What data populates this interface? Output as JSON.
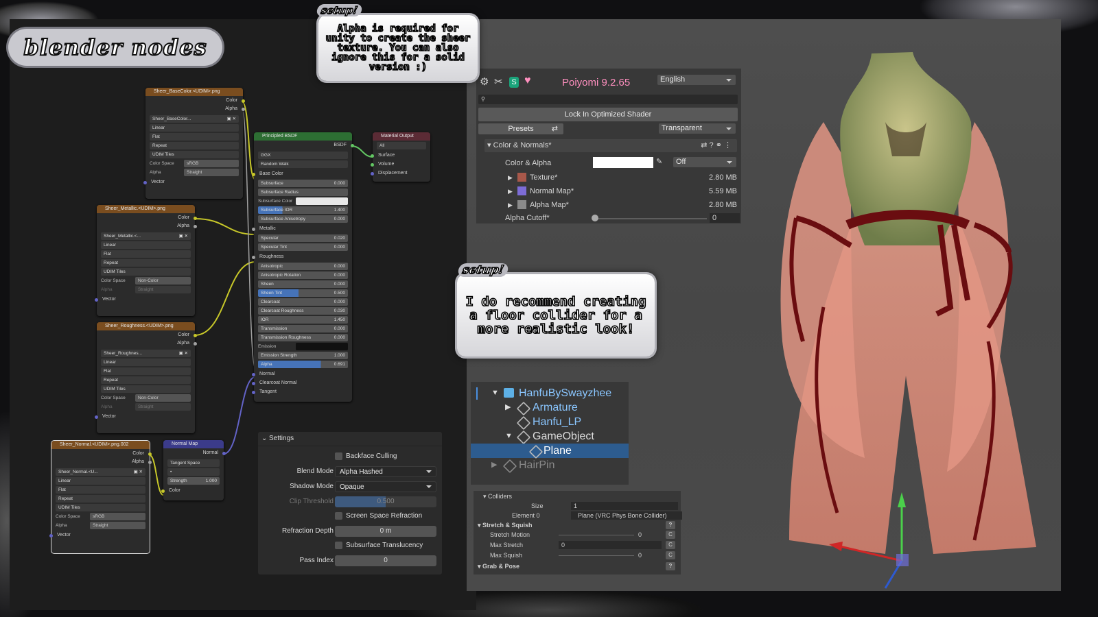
{
  "title": "blender nodes",
  "callout1": {
    "tag": "setup!",
    "text": "Alpha is required for unity to create the sheer texture. You can also ignore this for a solid version :)"
  },
  "callout2": {
    "tag": "setup!",
    "text": "I do recommend creating a floor collider for a more realistic look!"
  },
  "nodes": {
    "basecolor": {
      "title": "Sheer_BaseColor.<UDIM>.png",
      "out_color": "Color",
      "out_alpha": "Alpha",
      "image": "Sheer_BaseColor...",
      "interp": "Linear",
      "proj": "Flat",
      "ext": "Repeat",
      "src": "UDIM Tiles",
      "cs_label": "Color Space",
      "cs": "sRGB",
      "alpha_label": "Alpha",
      "alpha": "Straight",
      "vector": "Vector"
    },
    "metallic": {
      "title": "Sheer_Metallic.<UDIM>.png",
      "out_color": "Color",
      "out_alpha": "Alpha",
      "image": "Sheer_Metallic.<...",
      "interp": "Linear",
      "proj": "Flat",
      "ext": "Repeat",
      "src": "UDIM Tiles",
      "cs_label": "Color Space",
      "cs": "Non-Color",
      "alpha_label": "Alpha",
      "alpha": "Straight",
      "vector": "Vector"
    },
    "roughness": {
      "title": "Sheer_Roughness.<UDIM>.png",
      "out_color": "Color",
      "out_alpha": "Alpha",
      "image": "Sheer_Roughnes...",
      "interp": "Linear",
      "proj": "Flat",
      "ext": "Repeat",
      "src": "UDIM Tiles",
      "cs_label": "Color Space",
      "cs": "Non-Color",
      "alpha_label": "Alpha",
      "alpha": "Straight",
      "vector": "Vector"
    },
    "normal": {
      "title": "Sheer_Normal.<UDIM>.png.002",
      "out_color": "Color",
      "out_alpha": "Alpha",
      "image": "Sheer_Normal.<U...",
      "interp": "Linear",
      "proj": "Flat",
      "ext": "Repeat",
      "src": "UDIM Tiles",
      "cs_label": "Color Space",
      "cs": "sRGB",
      "alpha_label": "Alpha",
      "alpha": "Straight",
      "vector": "Vector"
    },
    "normalmap": {
      "title": "Normal Map",
      "out": "Normal",
      "space": "Tangent Space",
      "strength_label": "Strength",
      "strength": "1.000",
      "color": "Color"
    },
    "bsdf": {
      "title": "Principled BSDF",
      "out": "BSDF",
      "dist": "GGX",
      "sss": "Random Walk",
      "base_color": "Base Color",
      "rows": [
        {
          "l": "Subsurface",
          "v": "0.000"
        },
        {
          "l": "Subsurface Radius",
          "v": ""
        },
        {
          "l": "Subsurface Color",
          "v": ""
        },
        {
          "l": "Subsurface IOR",
          "v": "1.400"
        },
        {
          "l": "Subsurface Anisotropy",
          "v": "0.000"
        },
        {
          "l": "Metallic",
          "v": ""
        },
        {
          "l": "Specular",
          "v": "0.020"
        },
        {
          "l": "Specular Tint",
          "v": "0.000"
        },
        {
          "l": "Roughness",
          "v": ""
        },
        {
          "l": "Anisotropic",
          "v": "0.000"
        },
        {
          "l": "Anisotropic Rotation",
          "v": "0.000"
        },
        {
          "l": "Sheen",
          "v": "0.000"
        },
        {
          "l": "Sheen Tint",
          "v": "0.500"
        },
        {
          "l": "Clearcoat",
          "v": "0.000"
        },
        {
          "l": "Clearcoat Roughness",
          "v": "0.030"
        },
        {
          "l": "IOR",
          "v": "1.450"
        },
        {
          "l": "Transmission",
          "v": "0.000"
        },
        {
          "l": "Transmission Roughness",
          "v": "0.000"
        },
        {
          "l": "Emission",
          "v": ""
        },
        {
          "l": "Emission Strength",
          "v": "1.000"
        },
        {
          "l": "Alpha",
          "v": "0.691"
        },
        {
          "l": "Normal",
          "v": ""
        },
        {
          "l": "Clearcoat Normal",
          "v": ""
        },
        {
          "l": "Tangent",
          "v": ""
        }
      ]
    },
    "output": {
      "title": "Material Output",
      "target": "All",
      "surface": "Surface",
      "volume": "Volume",
      "displacement": "Displacement"
    }
  },
  "settings": {
    "title": "Settings",
    "backface": "Backface Culling",
    "blend_label": "Blend Mode",
    "blend": "Alpha Hashed",
    "shadow_label": "Shadow Mode",
    "shadow": "Opaque",
    "clip_label": "Clip Threshold",
    "clip": "0.500",
    "ssr": "Screen Space Refraction",
    "depth_label": "Refraction Depth",
    "depth": "0 m",
    "sst": "Subsurface Translucency",
    "pass_label": "Pass Index",
    "pass": "0"
  },
  "poiyomi": {
    "version": "Poiyomi 9.2.65",
    "language": "English",
    "lock": "Lock In Optimized Shader",
    "presets": "Presets",
    "render_mode": "Transparent",
    "section": "Color & Normals*",
    "color_alpha": "Color & Alpha",
    "off": "Off",
    "textures": [
      {
        "name": "Texture*",
        "size": "2.80 MB"
      },
      {
        "name": "Normal Map*",
        "size": "5.59 MB"
      },
      {
        "name": "Alpha Map*",
        "size": "2.80 MB"
      }
    ],
    "cutoff_label": "Alpha Cutoff*",
    "cutoff": "0"
  },
  "hierarchy": {
    "items": [
      {
        "name": "HanfuBySwayzhee"
      },
      {
        "name": "Armature"
      },
      {
        "name": "Hanfu_LP"
      },
      {
        "name": "GameObject"
      },
      {
        "name": "Plane"
      },
      {
        "name": "HairPin"
      }
    ]
  },
  "physbone": {
    "colliders": "Colliders",
    "size_label": "Size",
    "size": "1",
    "element_label": "Element 0",
    "element": "Plane (VRC Phys Bone Collider)",
    "stretch": "Stretch & Squish",
    "motion_label": "Stretch Motion",
    "motion": "0",
    "max_stretch_label": "Max Stretch",
    "max_stretch": "0",
    "max_squish_label": "Max Squish",
    "max_squish": "0",
    "grab": "Grab & Pose",
    "c": "C",
    "q": "?"
  },
  "colors": {
    "accent_pink": "#ff8fbf",
    "blue_select": "#2d5c8f"
  }
}
